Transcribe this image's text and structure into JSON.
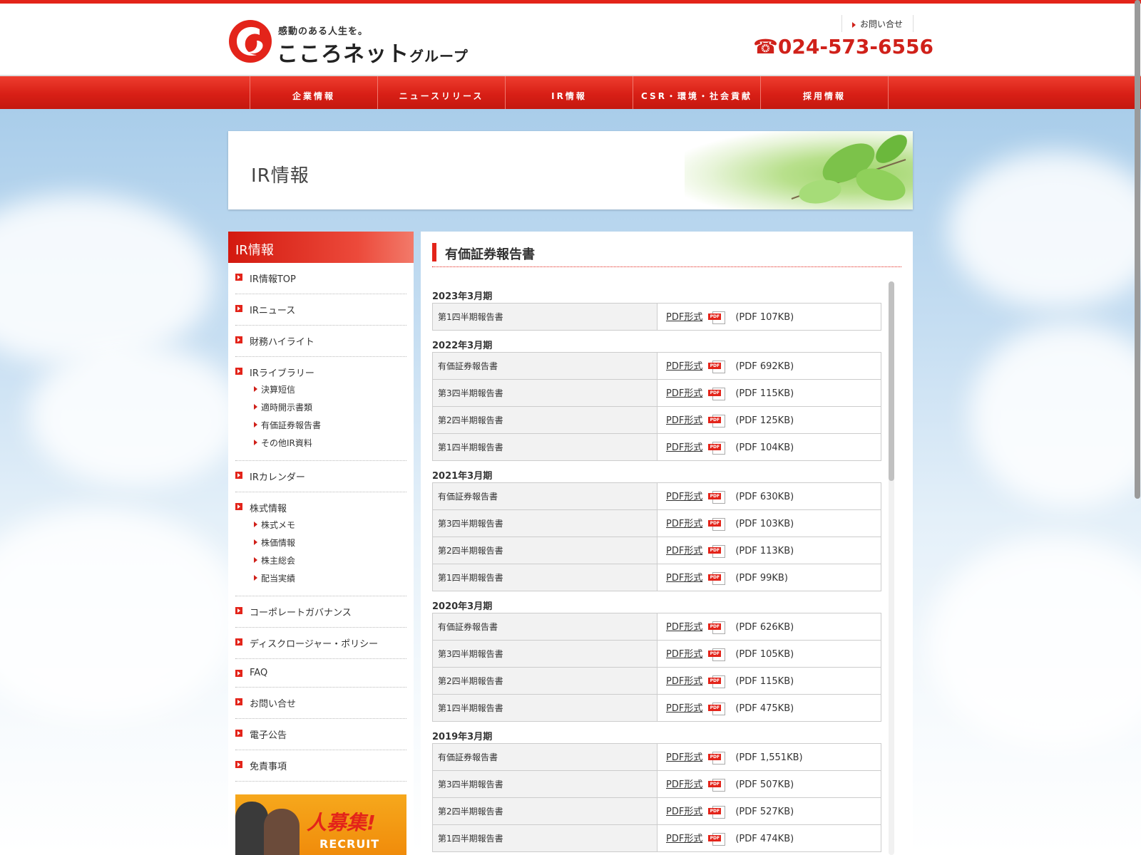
{
  "header": {
    "tagline": "感動のある人生を。",
    "logo_name": "こころネット",
    "logo_sub": "グループ",
    "contact_label": "お問い合せ",
    "phone": "☎024-573-6556"
  },
  "nav": {
    "items": [
      "企業情報",
      "ニュースリリース",
      "IR情報",
      "CSR・環境・社会貢献",
      "採用情報"
    ]
  },
  "banner": {
    "title": "IR情報"
  },
  "sidebar": {
    "title": "IR情報",
    "items": [
      {
        "label": "IR情報TOP"
      },
      {
        "label": "IRニュース"
      },
      {
        "label": "財務ハイライト"
      },
      {
        "label": "IRライブラリー",
        "subs": [
          "決算短信",
          "適時開示書類",
          "有価証券報告書",
          "その他IR資料"
        ]
      },
      {
        "label": "IRカレンダー"
      },
      {
        "label": "株式情報",
        "subs": [
          "株式メモ",
          "株価情報",
          "株主総会",
          "配当実績"
        ]
      },
      {
        "label": "コーポレートガバナンス"
      },
      {
        "label": "ディスクロージャー・ポリシー"
      },
      {
        "label": "FAQ"
      },
      {
        "label": "お問い合せ"
      },
      {
        "label": "電子公告"
      },
      {
        "label": "免責事項"
      }
    ],
    "recruit_title": "人募集!",
    "recruit_sub": "RECRUIT"
  },
  "main": {
    "title": "有価証券報告書",
    "link_label": "PDF形式",
    "pdf_icon_text": "PDF",
    "groups": [
      {
        "period": "2023年3月期",
        "rows": [
          {
            "name": "第1四半期報告書",
            "size": "(PDF 107KB)"
          }
        ]
      },
      {
        "period": "2022年3月期",
        "rows": [
          {
            "name": "有価証券報告書",
            "size": "(PDF 692KB)"
          },
          {
            "name": "第3四半期報告書",
            "size": "(PDF 115KB)"
          },
          {
            "name": "第2四半期報告書",
            "size": "(PDF 125KB)"
          },
          {
            "name": "第1四半期報告書",
            "size": "(PDF 104KB)"
          }
        ]
      },
      {
        "period": "2021年3月期",
        "rows": [
          {
            "name": "有価証券報告書",
            "size": "(PDF 630KB)"
          },
          {
            "name": "第3四半期報告書",
            "size": "(PDF 103KB)"
          },
          {
            "name": "第2四半期報告書",
            "size": "(PDF 113KB)"
          },
          {
            "name": "第1四半期報告書",
            "size": "(PDF 99KB)"
          }
        ]
      },
      {
        "period": "2020年3月期",
        "rows": [
          {
            "name": "有価証券報告書",
            "size": "(PDF 626KB)"
          },
          {
            "name": "第3四半期報告書",
            "size": "(PDF 105KB)"
          },
          {
            "name": "第2四半期報告書",
            "size": "(PDF 115KB)"
          },
          {
            "name": "第1四半期報告書",
            "size": "(PDF 475KB)"
          }
        ]
      },
      {
        "period": "2019年3月期",
        "rows": [
          {
            "name": "有価証券報告書",
            "size": "(PDF 1,551KB)"
          },
          {
            "name": "第3四半期報告書",
            "size": "(PDF 507KB)"
          },
          {
            "name": "第2四半期報告書",
            "size": "(PDF 527KB)"
          },
          {
            "name": "第1四半期報告書",
            "size": "(PDF 474KB)"
          }
        ]
      }
    ]
  },
  "colors": {
    "brand_red": "#e3241a"
  }
}
